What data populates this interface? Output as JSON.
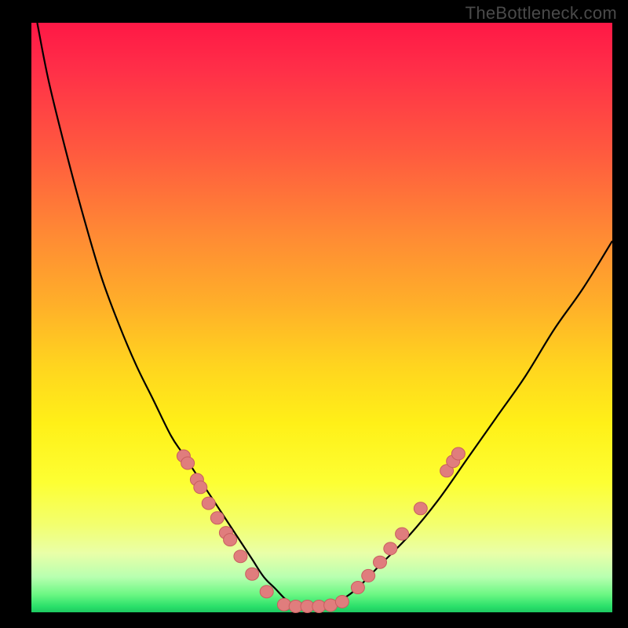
{
  "watermark": "TheBottleneck.com",
  "colors": {
    "frame": "#000000",
    "curve": "#000000",
    "marker_fill": "#e07d7d",
    "marker_stroke": "#c85f5f"
  },
  "chart_data": {
    "type": "line",
    "title": "",
    "xlabel": "",
    "ylabel": "",
    "xlim": [
      0,
      100
    ],
    "ylim": [
      0,
      100
    ],
    "series": [
      {
        "name": "bottleneck-curve",
        "x": [
          1,
          3,
          6,
          9,
          12,
          15,
          18,
          21,
          24,
          26,
          28,
          30,
          32,
          34,
          36,
          38,
          40,
          42,
          44,
          46,
          48,
          50,
          53,
          56,
          60,
          65,
          70,
          75,
          80,
          85,
          90,
          95,
          100
        ],
        "y": [
          100,
          90,
          78,
          67,
          57,
          49,
          42,
          36,
          30,
          27,
          24,
          21,
          18,
          15,
          12,
          9,
          6,
          4,
          2,
          1,
          1,
          1,
          2,
          4,
          8,
          13,
          19,
          26,
          33,
          40,
          48,
          55,
          63
        ]
      }
    ],
    "markers_left": [
      {
        "x": 26.2,
        "y": 26.5
      },
      {
        "x": 26.9,
        "y": 25.3
      },
      {
        "x": 28.5,
        "y": 22.5
      },
      {
        "x": 29.1,
        "y": 21.2
      },
      {
        "x": 30.5,
        "y": 18.5
      },
      {
        "x": 32.0,
        "y": 16.0
      },
      {
        "x": 33.5,
        "y": 13.5
      },
      {
        "x": 34.2,
        "y": 12.3
      },
      {
        "x": 36.0,
        "y": 9.5
      },
      {
        "x": 38.0,
        "y": 6.5
      },
      {
        "x": 40.5,
        "y": 3.5
      }
    ],
    "markers_bottom": [
      {
        "x": 43.5,
        "y": 1.3
      },
      {
        "x": 45.5,
        "y": 1.0
      },
      {
        "x": 47.5,
        "y": 1.0
      },
      {
        "x": 49.5,
        "y": 1.0
      },
      {
        "x": 51.5,
        "y": 1.2
      },
      {
        "x": 53.5,
        "y": 1.8
      }
    ],
    "markers_right": [
      {
        "x": 56.2,
        "y": 4.2
      },
      {
        "x": 58.0,
        "y": 6.2
      },
      {
        "x": 60.0,
        "y": 8.5
      },
      {
        "x": 61.8,
        "y": 10.8
      },
      {
        "x": 63.8,
        "y": 13.3
      },
      {
        "x": 67.0,
        "y": 17.6
      },
      {
        "x": 71.5,
        "y": 24.0
      },
      {
        "x": 72.6,
        "y": 25.6
      },
      {
        "x": 73.5,
        "y": 26.9
      }
    ]
  }
}
